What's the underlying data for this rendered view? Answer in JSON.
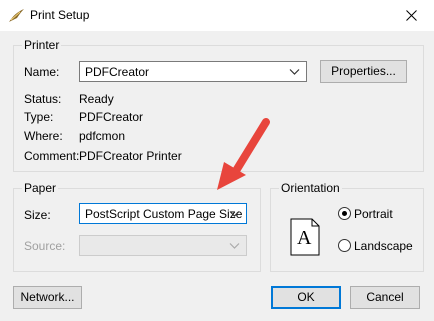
{
  "window": {
    "title": "Print Setup",
    "icon": "feather-quill-icon"
  },
  "printer": {
    "group_label": "Printer",
    "name_label": "Name:",
    "name_value": "PDFCreator",
    "properties_button": "Properties...",
    "status_label": "Status:",
    "status_value": "Ready",
    "type_label": "Type:",
    "type_value": "PDFCreator",
    "where_label": "Where:",
    "where_value": "pdfcmon",
    "comment_label": "Comment:",
    "comment_value": "PDFCreator Printer"
  },
  "paper": {
    "group_label": "Paper",
    "size_label": "Size:",
    "size_value": "PostScript Custom Page Size",
    "source_label": "Source:",
    "source_value": ""
  },
  "orientation": {
    "group_label": "Orientation",
    "preview_letter": "A",
    "portrait_label": "Portrait",
    "landscape_label": "Landscape",
    "selected": "Portrait"
  },
  "buttons": {
    "network": "Network...",
    "ok": "OK",
    "cancel": "Cancel"
  },
  "annotation": {
    "arrow_color": "#e8453c"
  }
}
